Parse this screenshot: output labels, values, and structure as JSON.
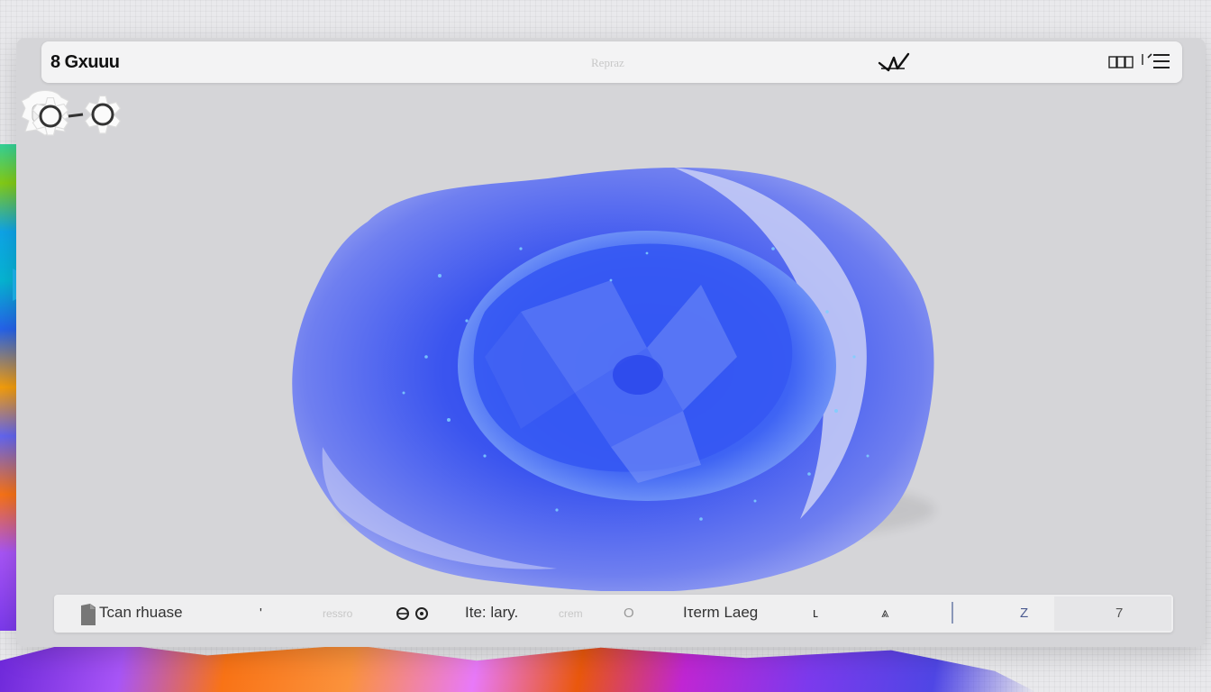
{
  "window": {
    "title": "8 Gxuuu",
    "center_caption": "Repraz",
    "topbar_right_label": "ooo"
  },
  "icons": {
    "mark": "scribble-mark-icon",
    "box": "window-box-icon",
    "menu": "hamburger-menu-icon",
    "ghost": "ghost-avatar-icon",
    "gears": "gear-pair-icon",
    "left_arrow": "play-arrow-icon",
    "tool_doc": "document-icon",
    "tool_dual": "double-circle-icon"
  },
  "toolbar": {
    "item_1": "Tcan rhuase",
    "item_1_sub": "",
    "item_2": "'",
    "item_3": "ressro",
    "item_4": "Ite: lary.",
    "item_5": "crem",
    "item_6": "Ο",
    "item_7": "Ιτerm Laeg",
    "item_8": "ʟ",
    "item_9": "⩓",
    "item_10": "Z",
    "item_11": "7"
  },
  "colors": {
    "blob_main": "#5a6cf0",
    "blob_deep": "#2f4ae8",
    "window_bg": "#d5d5d8",
    "bar_bg": "#f3f3f4"
  }
}
